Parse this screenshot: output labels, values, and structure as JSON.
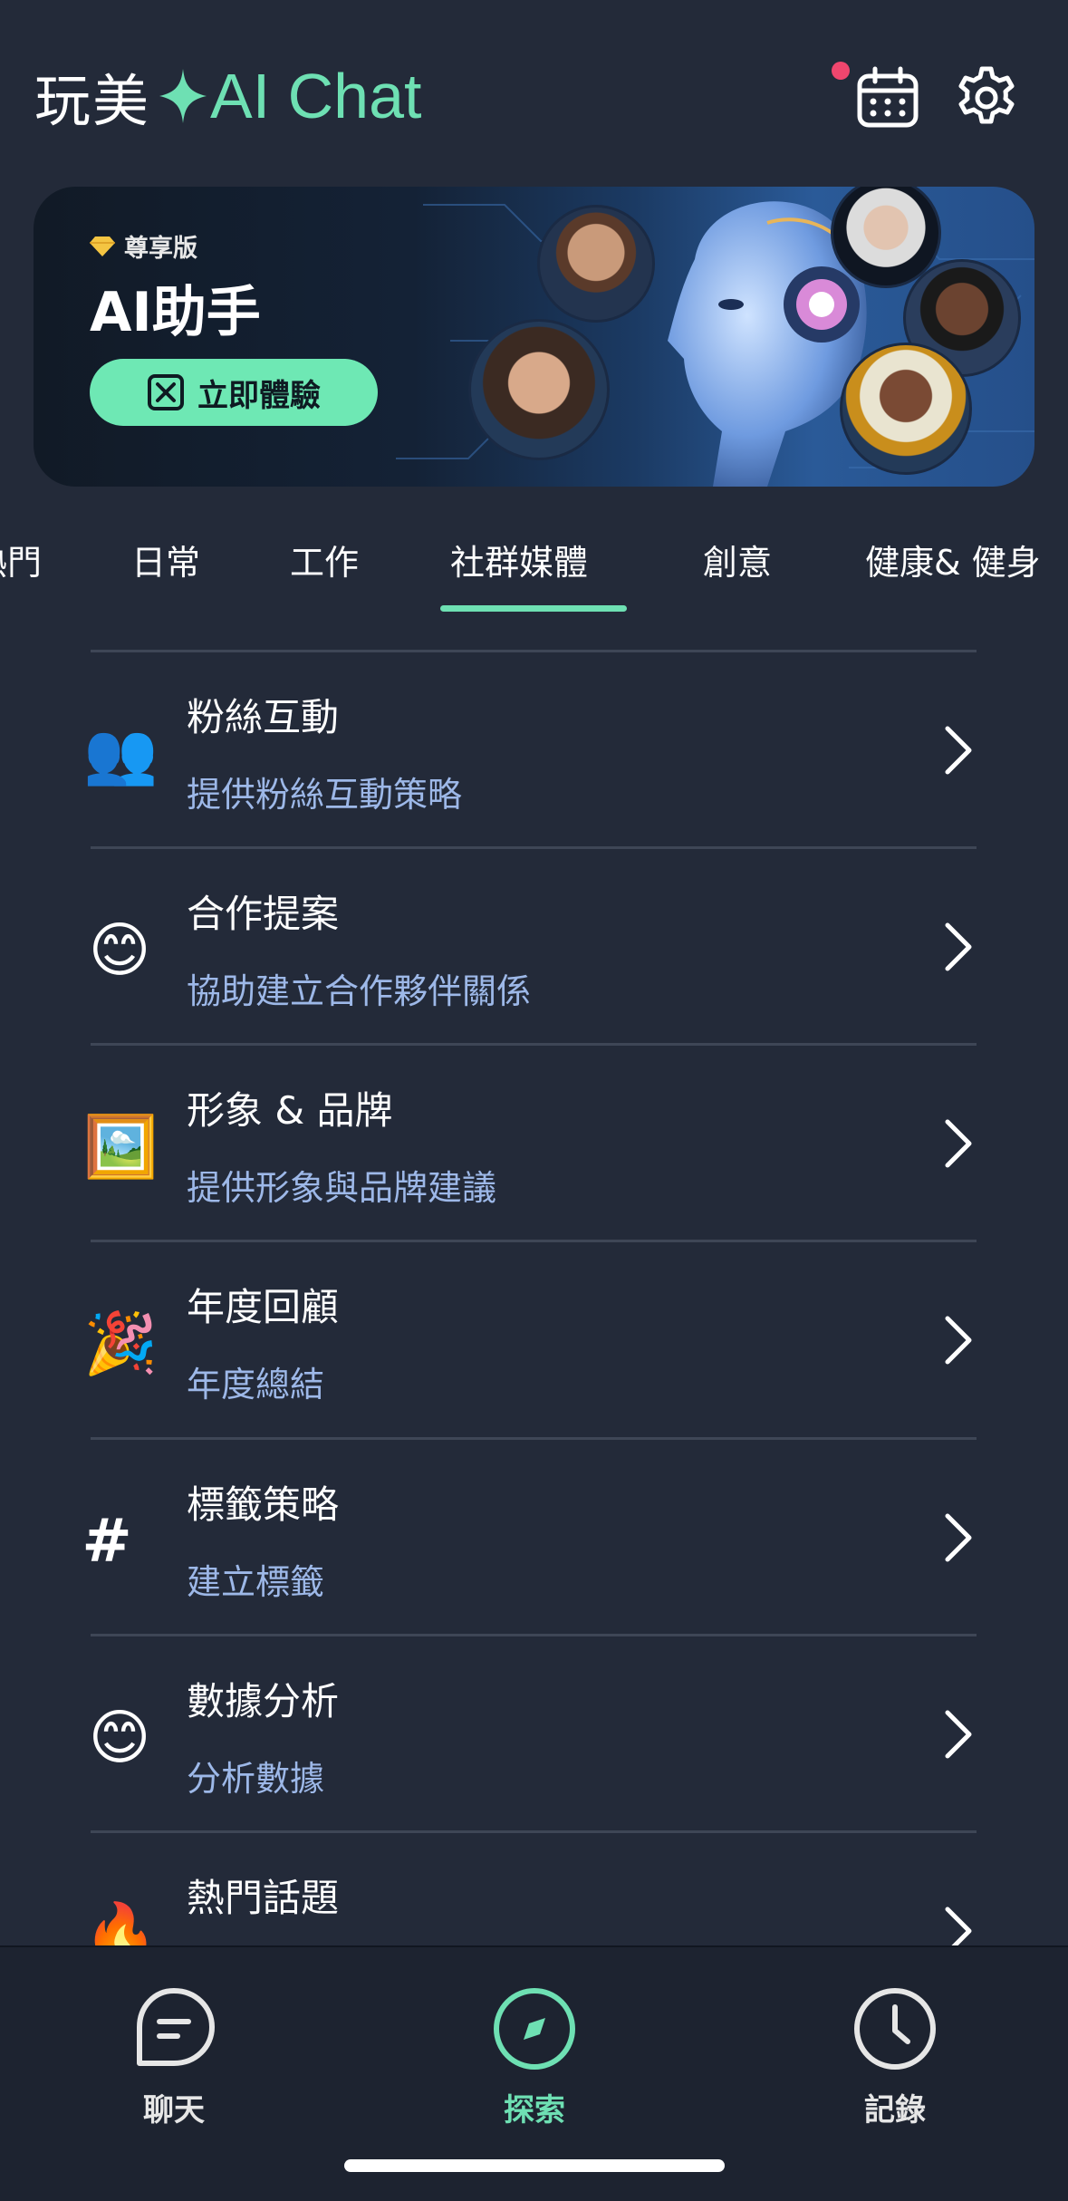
{
  "header": {
    "title_cn": "玩美",
    "title_ai": "AI Chat",
    "calendar_icon": "calendar-icon",
    "settings_icon": "gear-icon",
    "accent_color": "#6ee0b3",
    "notification_dot_color": "#f0466e"
  },
  "banner": {
    "badge": "尊享版",
    "title": "AI助手",
    "cta_label": "立即體驗"
  },
  "tabs": [
    {
      "label": "熱門"
    },
    {
      "label": "日常"
    },
    {
      "label": "工作"
    },
    {
      "label": "社群媒體",
      "selected": true
    },
    {
      "label": "創意"
    },
    {
      "label": "健康& 健身"
    }
  ],
  "items": [
    {
      "icon": "👥",
      "title": "粉絲互動",
      "subtitle": "提供粉絲互動策略"
    },
    {
      "icon": "😊",
      "title": "合作提案",
      "subtitle": "協助建立合作夥伴關係"
    },
    {
      "icon": "🖼️",
      "title": "形象 & 品牌",
      "subtitle": "提供形象與品牌建議"
    },
    {
      "icon": "🎉",
      "title": "年度回顧",
      "subtitle": "年度總結"
    },
    {
      "icon": "#",
      "title": "標籤策略",
      "subtitle": "建立標籤"
    },
    {
      "icon": "😊",
      "title": "數據分析",
      "subtitle": "分析數據"
    },
    {
      "icon": "🔥",
      "title": "熱門話題",
      "subtitle": ""
    }
  ],
  "bottom_nav": [
    {
      "label": "聊天",
      "icon": "chat-icon",
      "active": false
    },
    {
      "label": "探索",
      "icon": "compass-icon",
      "active": true
    },
    {
      "label": "記錄",
      "icon": "clock-icon",
      "active": false
    }
  ],
  "colors": {
    "background": "#232a39",
    "subtitle": "#9db8e8",
    "cta_background": "#6ee8b4",
    "nav_inactive": "#e6e6e6"
  }
}
